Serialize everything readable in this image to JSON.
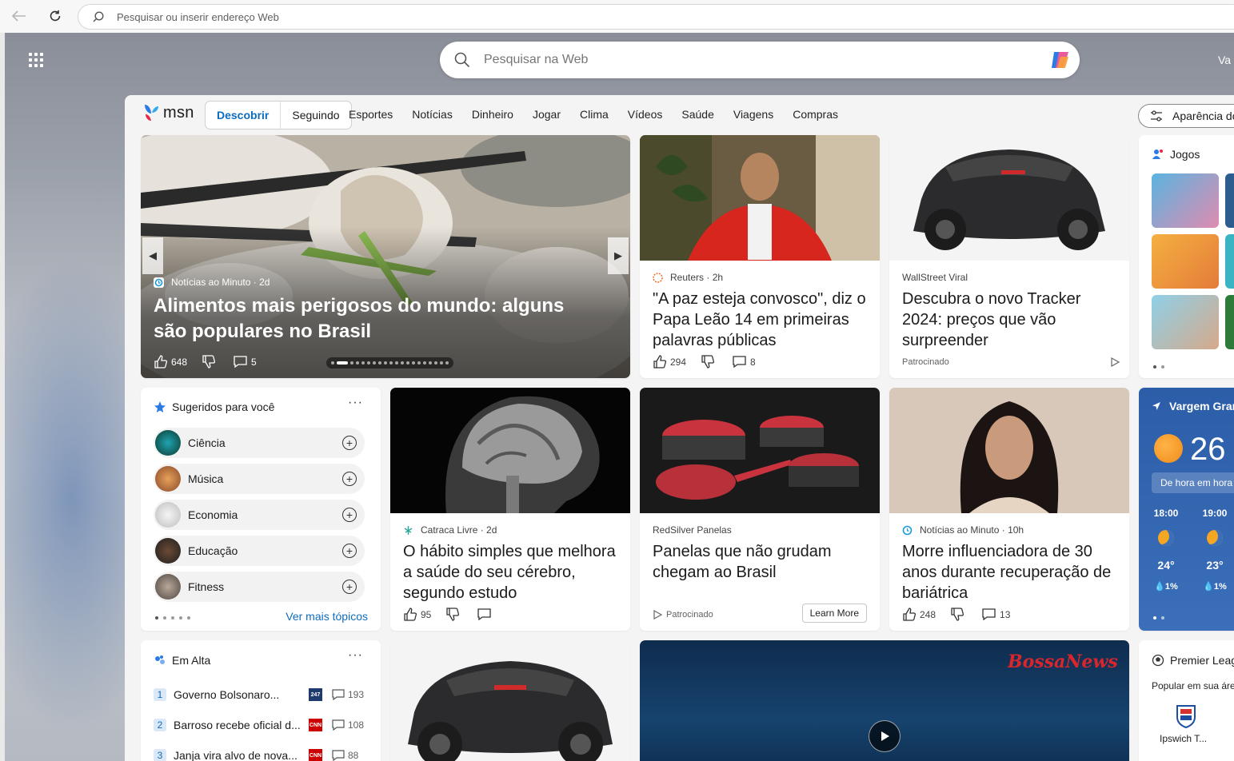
{
  "browser": {
    "address_placeholder": "Pesquisar ou inserir endereço Web"
  },
  "newtab": {
    "search_placeholder": "Pesquisar na Web",
    "user_fragment": "Va"
  },
  "msn": {
    "brand": "msn",
    "segments": [
      "Descobrir",
      "Seguindo"
    ],
    "nav": [
      "Esportes",
      "Notícias",
      "Dinheiro",
      "Jogar",
      "Clima",
      "Vídeos",
      "Saúde",
      "Viagens",
      "Compras"
    ],
    "appearance_label": "Aparência do"
  },
  "hero": {
    "source": "Notícias ao Minuto",
    "age": "· 2d",
    "title": "Alimentos mais perigosos do mundo: alguns são populares no Brasil",
    "likes": "648",
    "comments": "5"
  },
  "card_pope": {
    "source": "Reuters",
    "age": "· 2h",
    "title": "\"A paz esteja convosco\", diz o Papa Leão 14 em primeiras palavras públicas",
    "likes": "294",
    "comments": "8"
  },
  "card_tracker": {
    "source": "WallStreet Viral",
    "title": "Descubra o novo Tracker 2024: preços que vão surpreender",
    "sponsored": "Patrocinado"
  },
  "games": {
    "title": "Jogos"
  },
  "suggested": {
    "title": "Sugeridos para você",
    "more": "···",
    "topics": [
      "Ciência",
      "Música",
      "Economia",
      "Educação",
      "Fitness"
    ],
    "see_more": "Ver mais tópicos"
  },
  "card_brain": {
    "source": "Catraca Livre",
    "age": "· 2d",
    "title": "O hábito simples que melhora a saúde do seu cérebro, segundo estudo",
    "likes": "95"
  },
  "card_pans": {
    "source": "RedSilver Panelas",
    "title": "Panelas que não grudam chegam ao Brasil",
    "sponsored": "Patrocinado",
    "cta": "Learn More"
  },
  "card_influencer": {
    "source": "Notícias ao Minuto",
    "age": "· 10h",
    "title": "Morre influenciadora de 30 anos durante recuperação de bariátrica",
    "likes": "248",
    "comments": "13"
  },
  "weather": {
    "location": "Vargem Gran",
    "temp": "26",
    "tab": "De hora em hora",
    "hours": [
      {
        "time": "18:00",
        "temp": "24°",
        "precip": "💧1%"
      },
      {
        "time": "19:00",
        "temp": "23°",
        "precip": "💧1%"
      }
    ]
  },
  "trending": {
    "title": "Em Alta",
    "more": "···",
    "items": [
      {
        "n": "1",
        "title": "Governo Bolsonaro...",
        "source_logo": "247",
        "comments": "193"
      },
      {
        "n": "2",
        "title": "Barroso recebe oficial d...",
        "source_logo": "CNN",
        "comments": "108"
      },
      {
        "n": "3",
        "title": "Janja vira alvo de nova...",
        "source_logo": "CNN",
        "comments": "88"
      }
    ]
  },
  "video": {
    "brand": "BossaNews"
  },
  "league": {
    "title": "Premier Leag",
    "subtitle": "Popular em sua áre",
    "team": "Ipswich T..."
  },
  "colors": {
    "accent": "#0f6cbd",
    "weather_bg": "#3b6fb9"
  }
}
